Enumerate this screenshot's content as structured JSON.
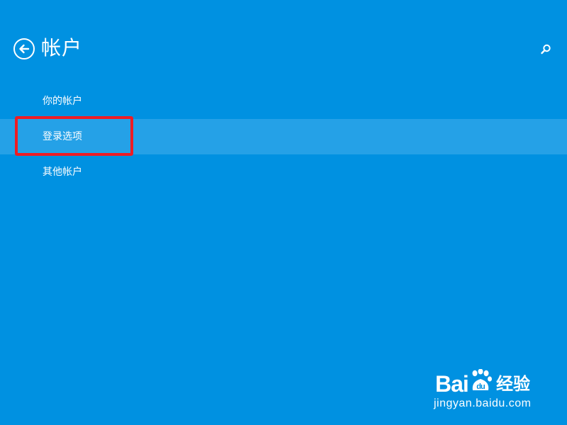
{
  "header": {
    "title": "帐户",
    "back_icon": "back-arrow-icon",
    "search_icon": "search-icon"
  },
  "nav": {
    "items": [
      {
        "label": "你的帐户",
        "selected": false
      },
      {
        "label": "登录选项",
        "selected": true
      },
      {
        "label": "其他帐户",
        "selected": false
      }
    ]
  },
  "annotation": {
    "highlight_color": "#ee1c24"
  },
  "watermark": {
    "brand": "Baidu",
    "suffix": "经验",
    "url": "jingyan.baidu.com"
  },
  "colors": {
    "background": "#0091e1",
    "selected_row": "#25a1e7",
    "text": "#ffffff"
  }
}
